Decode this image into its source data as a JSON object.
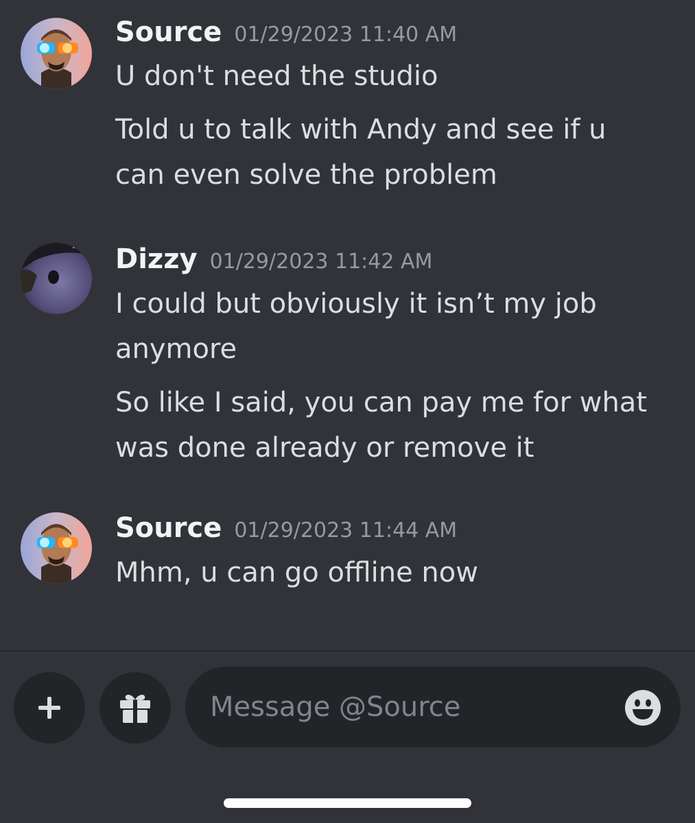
{
  "messages": [
    {
      "author": "Source",
      "timestamp": "01/29/2023 11:40 AM",
      "avatar_icon": "source-avatar-icon",
      "lines": [
        "U don't need the studio",
        "Told u to talk with Andy and see if u can even solve the problem"
      ]
    },
    {
      "author": "Dizzy",
      "timestamp": "01/29/2023 11:42 AM",
      "avatar_icon": "dizzy-avatar-icon",
      "lines": [
        "I could but obviously it isn’t my job anymore",
        "So like I said, you can pay me for what was done already or remove it"
      ]
    },
    {
      "author": "Source",
      "timestamp": "01/29/2023 11:44 AM",
      "avatar_icon": "source-avatar-icon",
      "lines": [
        "Mhm, u can go offline now"
      ]
    }
  ],
  "composer": {
    "plus_icon": "plus-icon",
    "gift_icon": "gift-icon",
    "emoji_icon": "emoji-icon",
    "placeholder": "Message @Source",
    "value": ""
  },
  "colors": {
    "background": "#313338",
    "input_background": "#232428",
    "author": "#f2f3f5",
    "message_text": "#dbdee1",
    "timestamp": "#949ba4",
    "placeholder": "#80848e"
  }
}
